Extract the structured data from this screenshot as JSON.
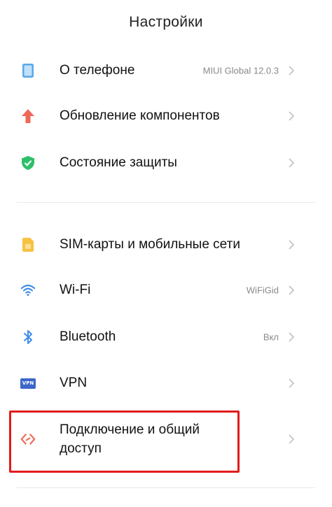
{
  "header": {
    "title": "Настройки"
  },
  "groups": [
    [
      {
        "label": "О телефоне",
        "value": "MIUI Global 12.0.3",
        "icon": "phone-icon"
      },
      {
        "label": "Обновление компонентов",
        "value": "",
        "icon": "arrow-up-icon"
      },
      {
        "label": "Состояние защиты",
        "value": "",
        "icon": "shield-check-icon"
      }
    ],
    [
      {
        "label": "SIM-карты и мобильные сети",
        "value": "",
        "icon": "sim-card-icon"
      },
      {
        "label": "Wi-Fi",
        "value": "WiFiGid",
        "icon": "wifi-icon"
      },
      {
        "label": "Bluetooth",
        "value": "Вкл",
        "icon": "bluetooth-icon"
      },
      {
        "label": "VPN",
        "value": "",
        "icon": "vpn-icon",
        "badge": "VPN"
      },
      {
        "label": "Подключение и общий доступ",
        "label_line1": "Подключение и общий",
        "label_line2": "доступ",
        "value": "",
        "icon": "connection-sharing-icon"
      }
    ]
  ],
  "colors": {
    "highlight_border": "#e21b1b",
    "phone_icon": "#5aa7e8",
    "update_icon": "#ee6a57",
    "shield_icon": "#2fbf6b",
    "sim_icon": "#f5c242",
    "wifi_icon": "#3f8de8",
    "bluetooth_icon": "#3f8de8",
    "vpn_icon": "#3d66c9",
    "sharing_icon": "#ee6a57"
  }
}
